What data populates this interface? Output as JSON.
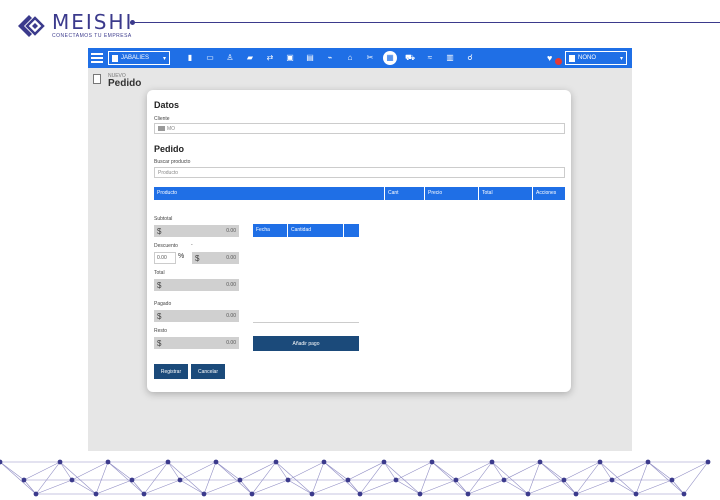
{
  "brand": {
    "title": "MEISHI",
    "subtitle": "CONECTAMOS TU EMPRESA"
  },
  "colors": {
    "brand": "#3b3a8c",
    "accent": "#1f6fe6",
    "button_dark": "#1b4a7a"
  },
  "topbar": {
    "branch": "JABALIES",
    "user": "NONO",
    "icons": [
      "chart-icon",
      "cash-icon",
      "person-icon",
      "truck-icon",
      "transfer-icon",
      "box-icon",
      "printer-icon",
      "tag-icon",
      "basket-icon",
      "scissors-icon",
      "pos-icon",
      "cart-icon",
      "exchange-icon",
      "document-icon",
      "catalog-icon"
    ]
  },
  "page": {
    "overline": "NUEVO",
    "title": "Pedido"
  },
  "datos": {
    "heading": "Datos",
    "cliente_label": "Cliente",
    "cliente_value": "MO"
  },
  "pedido": {
    "heading": "Pedido",
    "buscar_label": "Buscar producto",
    "buscar_placeholder": "Producto",
    "columns": [
      "Producto",
      "Cant",
      "Precio",
      "Total",
      "Acciones"
    ]
  },
  "totals": {
    "subtotal_label": "Subtotal",
    "subtotal_value": "0.00",
    "descuento_label": "Descuento",
    "descuento_dash": "-",
    "descuento_pct": "0.00",
    "pct_symbol": "%",
    "descuento_value": "0.00",
    "total_label": "Total",
    "total_value": "0.00",
    "pagado_label": "Pagado",
    "pagado_value": "0.00",
    "resto_label": "Resto",
    "resto_value": "0.00",
    "currency": "$"
  },
  "payments": {
    "columns": [
      "Fecha",
      "Cantidad",
      ""
    ],
    "add_button": "Añadir pago"
  },
  "actions": {
    "register": "Registrar",
    "cancel": "Cancelar"
  }
}
